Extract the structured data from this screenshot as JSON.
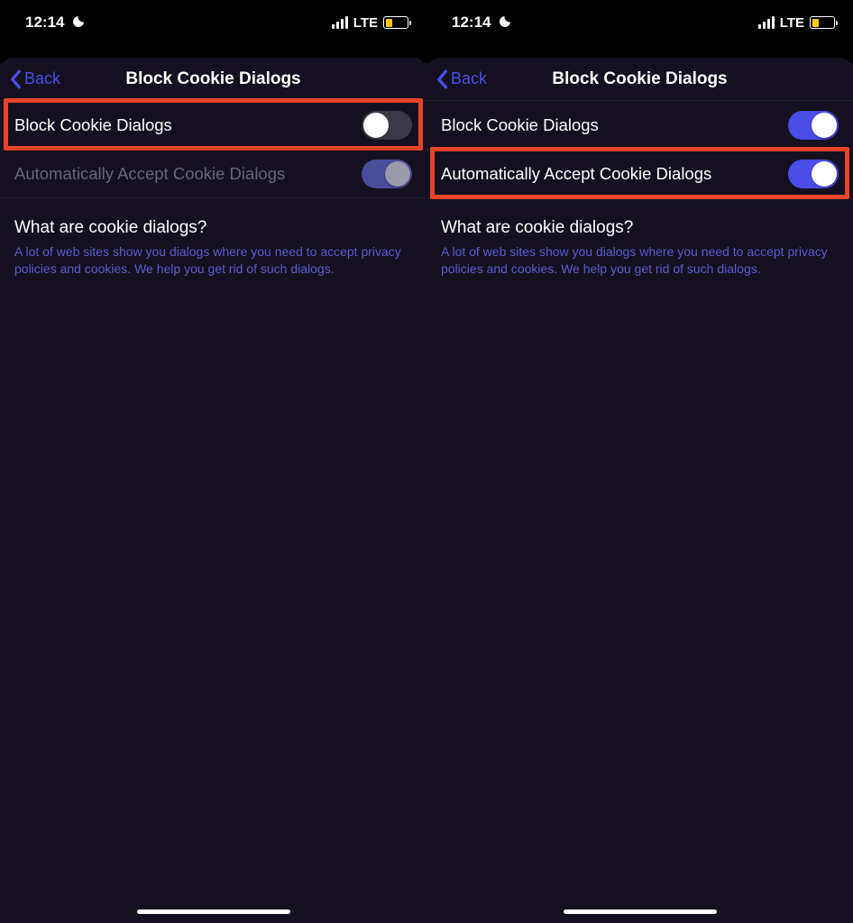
{
  "status": {
    "time": "12:14",
    "network_label": "LTE"
  },
  "nav": {
    "back_label": "Back",
    "title": "Block Cookie Dialogs"
  },
  "screens": [
    {
      "rows": [
        {
          "label": "Block Cookie Dialogs",
          "toggle_state": "off",
          "dimmed": false
        },
        {
          "label": "Automatically Accept Cookie Dialogs",
          "toggle_state": "on-dim",
          "dimmed": true
        }
      ],
      "highlight_row_index": 0
    },
    {
      "rows": [
        {
          "label": "Block Cookie Dialogs",
          "toggle_state": "on",
          "dimmed": false
        },
        {
          "label": "Automatically Accept Cookie Dialogs",
          "toggle_state": "on",
          "dimmed": false
        }
      ],
      "highlight_row_index": 1
    }
  ],
  "info": {
    "title": "What are cookie dialogs?",
    "text": "A lot of web sites show you dialogs where you need to accept privacy policies and cookies. We help you get rid of such dialogs."
  }
}
